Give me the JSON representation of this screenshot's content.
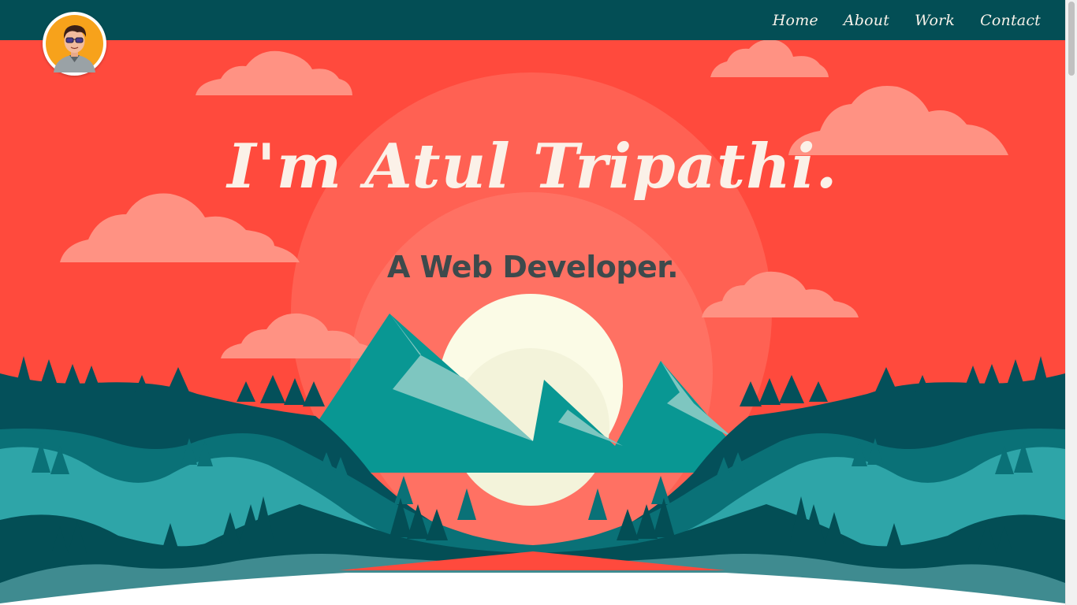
{
  "nav": {
    "items": [
      {
        "label": "Home"
      },
      {
        "label": "About"
      },
      {
        "label": "Work"
      },
      {
        "label": "Contact"
      }
    ]
  },
  "hero": {
    "headline": "I'm Atul Tripathi.",
    "subheadline": "A Web Developer."
  },
  "colors": {
    "topbar": "#034e55",
    "sky": "#ff4a3d",
    "headline": "#fbf1e8",
    "subheadline": "#3d4a4c",
    "sun": "#fbfbe6",
    "mountain": "#099793",
    "forest_dark": "#04505a",
    "forest_mid": "#0a7177",
    "forest_light": "#2ea5a8"
  },
  "icons": {
    "avatar": "cartoon-person-avatar"
  }
}
